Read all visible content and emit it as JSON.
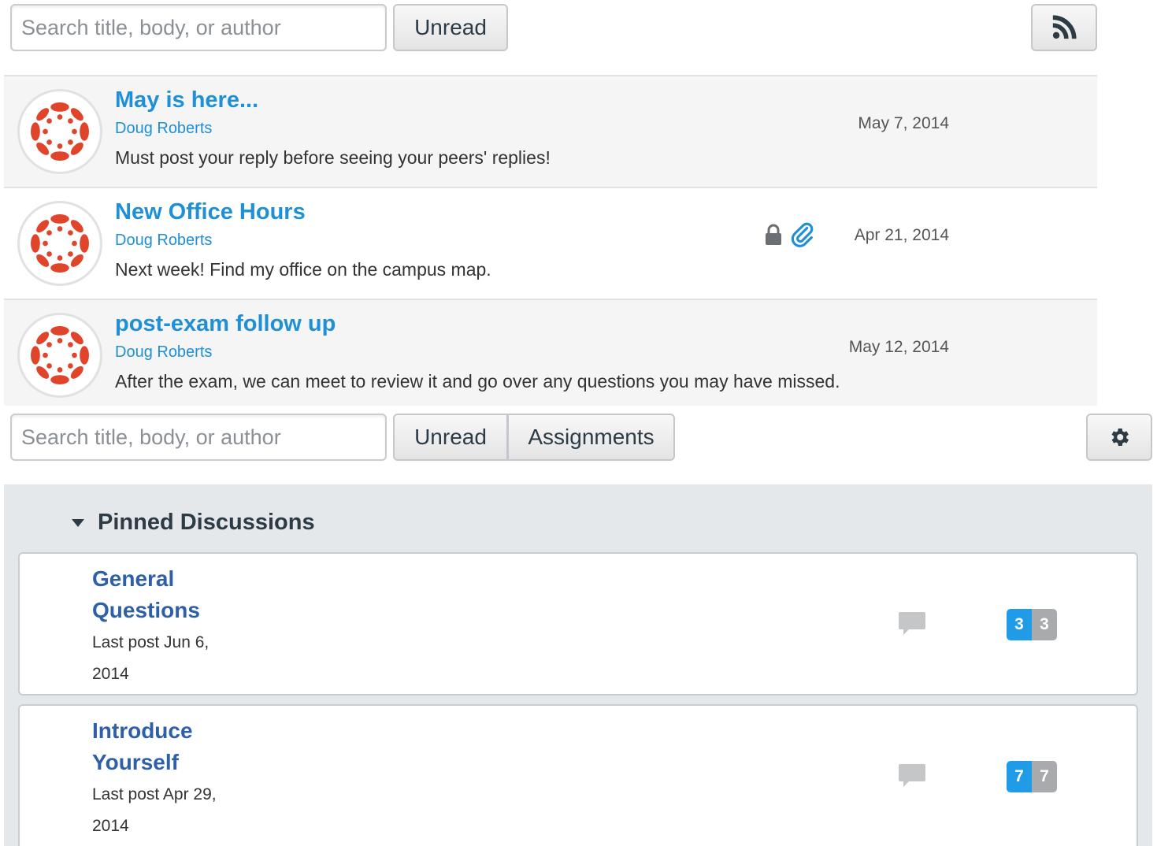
{
  "top_toolbar": {
    "search_placeholder": "Search title, body, or author",
    "unread_label": "Unread",
    "rss_icon": "rss-icon"
  },
  "announcements": [
    {
      "title": "May is here...",
      "author": "Doug Roberts",
      "body": "Must post your reply before seeing your peers' replies!",
      "date": "May 7, 2014",
      "icons": []
    },
    {
      "title": "New Office Hours",
      "author": "Doug Roberts",
      "body": "Next week! Find my office on the campus map.",
      "date": "Apr 21, 2014",
      "icons": [
        "lock-icon",
        "paperclip-icon"
      ]
    },
    {
      "title": "post-exam follow up",
      "author": "Doug Roberts",
      "body": "After the exam, we can meet to review it and go over any questions you may have missed.",
      "date": "May 12, 2014",
      "icons": []
    }
  ],
  "discussion_toolbar": {
    "search_placeholder": "Search title, body, or author",
    "unread_label": "Unread",
    "assignments_label": "Assignments",
    "settings_icon": "gear-icon"
  },
  "pinned": {
    "header": "Pinned Discussions",
    "items": [
      {
        "title_line1": "General",
        "title_line2": "Questions",
        "meta_line1": "Last post Jun 6,",
        "meta_line2": "2014",
        "unread_count": "3",
        "total_count": "3"
      },
      {
        "title_line1": "Introduce",
        "title_line2": "Yourself",
        "meta_line1": "Last post Apr 29,",
        "meta_line2": "2014",
        "unread_count": "7",
        "total_count": "7"
      }
    ]
  },
  "colors": {
    "link": "#1f8fd7",
    "pinned_title": "#2e5fa8",
    "avatar_red": "#e0452b",
    "badge_blue": "#1f9be8",
    "badge_gray": "#a8aaad",
    "pinned_bg": "#e5e8eb"
  }
}
